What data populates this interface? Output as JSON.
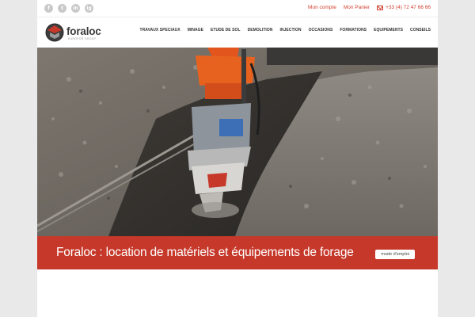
{
  "social": [
    "f",
    "t",
    "in",
    "ig"
  ],
  "topbar": {
    "account": "Mon compte",
    "cart": "Mon Panier",
    "phone": "+33 (4) 72 47 66 66"
  },
  "logo": {
    "name": "foraloc",
    "tagline": "EUROFOR GROUP"
  },
  "nav": [
    "TRAVAUX SPECIAUX",
    "MINAGE",
    "ETUDE DE SOL",
    "DEMOLITION",
    "INJECTION",
    "OCCASIONS",
    "FORMATIONS",
    "EQUIPEMENTS",
    "CONSEILS"
  ],
  "banner": {
    "title": "Foraloc : location de matériels et équipements de forage",
    "button": "mode d'emploi"
  },
  "colors": {
    "accent": "#c6382a",
    "link": "#d0402f",
    "text": "#333333"
  },
  "icons": [
    "facebook-icon",
    "twitter-icon",
    "linkedin-icon",
    "instagram-icon",
    "mail-icon"
  ]
}
